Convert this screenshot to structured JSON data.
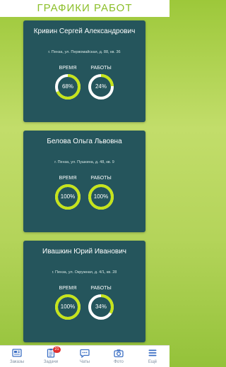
{
  "header": {
    "title": "ГРАФИКИ РАБОТ"
  },
  "labels": {
    "time": "ВРЕМЯ",
    "work": "РАБОТЫ"
  },
  "colors": {
    "accent": "#c5e41a",
    "card": "#25555c",
    "track": "#ffffff"
  },
  "employees": [
    {
      "name": "Кривин Сергей Александрович",
      "address": "г. Пенза, ул. Первомайская, д. 88, кв. 36",
      "time": {
        "text": "68%",
        "value": 68
      },
      "work": {
        "text": "24%",
        "value": 24
      }
    },
    {
      "name": "Белова Ольга Львовна",
      "address": "г. Пенза, ул. Пушкина, д. 48, кв. 9",
      "time": {
        "text": "100%",
        "value": 100
      },
      "work": {
        "text": "100%",
        "value": 100
      }
    },
    {
      "name": "Ивашкин Юрий Иванович",
      "address": "г. Пенза, ул. Окружная, д. 4/1, кв. 28",
      "time": {
        "text": "100%",
        "value": 100
      },
      "work": {
        "text": "34%",
        "value": 34
      }
    }
  ],
  "nav": [
    {
      "label": "Заказы",
      "icon": "newspaper-icon"
    },
    {
      "label": "Задачи",
      "icon": "clipboard-icon",
      "badge": "21"
    },
    {
      "label": "Чаты",
      "icon": "chat-icon"
    },
    {
      "label": "Фото",
      "icon": "camera-icon"
    },
    {
      "label": "Ещё",
      "icon": "menu-icon"
    }
  ]
}
